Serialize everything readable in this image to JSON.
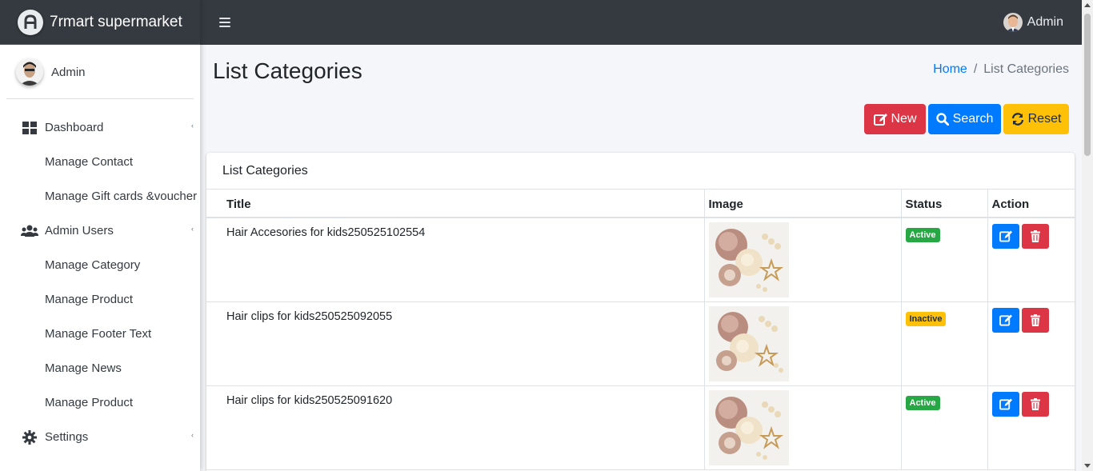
{
  "brand": {
    "name": "7rmart supermarket"
  },
  "sidebar": {
    "user": "Admin",
    "items": [
      {
        "label": "Dashboard",
        "icon": "dashboard-icon",
        "type": "parent"
      },
      {
        "label": "Manage Contact",
        "type": "sub"
      },
      {
        "label": "Manage Gift cards &voucher",
        "type": "sub"
      },
      {
        "label": "Admin Users",
        "icon": "users-icon",
        "type": "parent"
      },
      {
        "label": "Manage Category",
        "type": "sub"
      },
      {
        "label": "Manage Product",
        "type": "sub"
      },
      {
        "label": "Manage Footer Text",
        "type": "sub"
      },
      {
        "label": "Manage News",
        "type": "sub"
      },
      {
        "label": "Manage Product",
        "type": "sub"
      },
      {
        "label": "Settings",
        "icon": "gear-icon",
        "type": "parent"
      }
    ]
  },
  "topbar": {
    "user": "Admin"
  },
  "page": {
    "title": "List Categories"
  },
  "breadcrumb": {
    "home": "Home",
    "separator": "/",
    "current": "List Categories"
  },
  "toolbar": {
    "new_label": "New",
    "search_label": "Search",
    "reset_label": "Reset"
  },
  "card": {
    "title": "List Categories"
  },
  "table": {
    "headers": {
      "title": "Title",
      "image": "Image",
      "status": "Status",
      "action": "Action"
    },
    "rows": [
      {
        "title": "Hair Accesories for kids250525102554",
        "status": "Active"
      },
      {
        "title": "Hair clips for kids250525092055",
        "status": "Inactive"
      },
      {
        "title": "Hair clips for kids250525091620",
        "status": "Active"
      }
    ]
  },
  "colors": {
    "navbar": "#343a40",
    "primary": "#007bff",
    "danger": "#dc3545",
    "warning": "#ffc107",
    "success": "#28a745"
  }
}
